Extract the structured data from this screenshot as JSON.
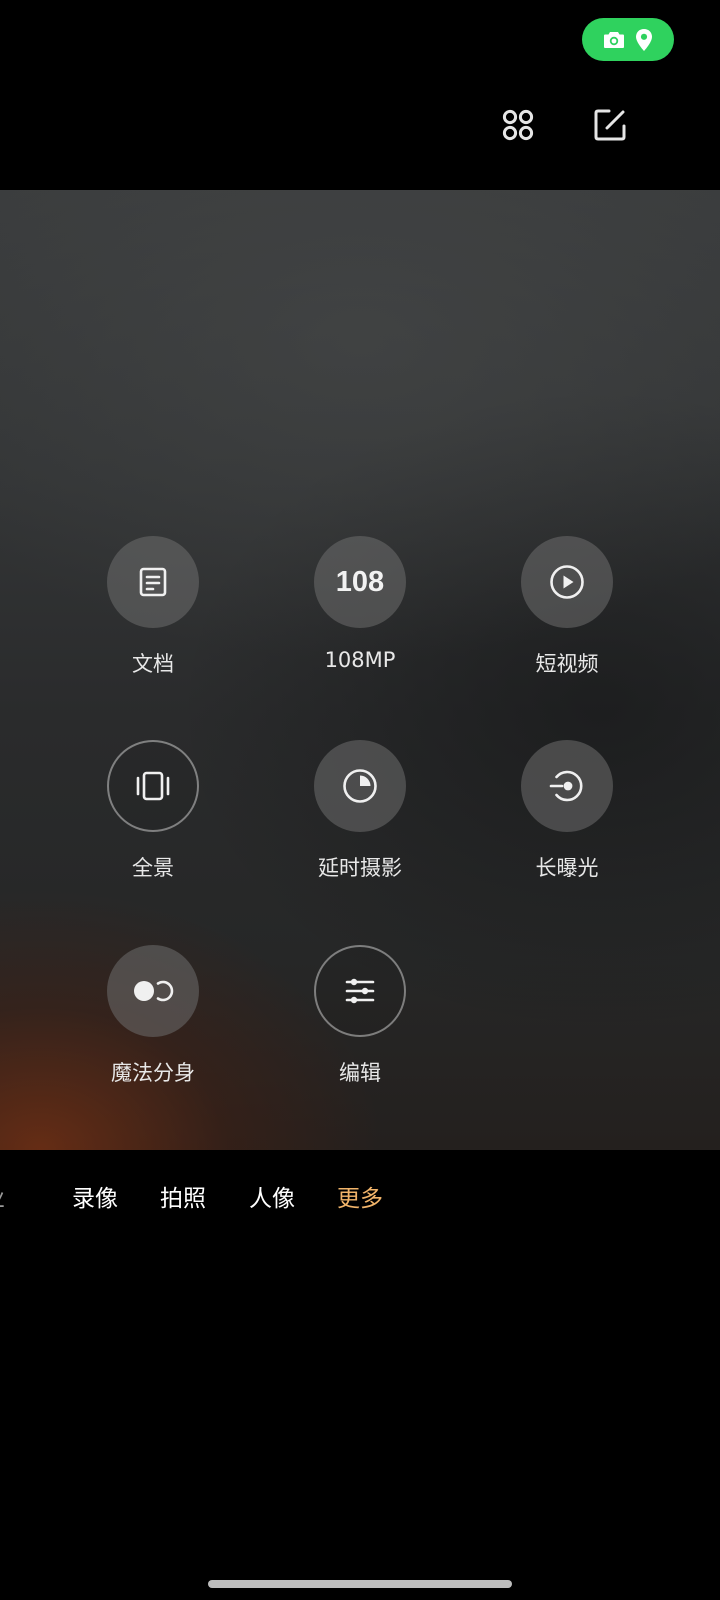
{
  "colors": {
    "status_pill": "#2fd25e",
    "accent_selected_tab": "#f1b46a",
    "background": "#000000"
  },
  "status_pill": {
    "icons": [
      "camera-icon",
      "location-pin-icon"
    ]
  },
  "toolbar": {
    "icons": [
      "more-apps-icon",
      "edit-icon"
    ]
  },
  "modes": {
    "document": {
      "label": "文档",
      "icon": "document-icon"
    },
    "mp108": {
      "label": "108MP",
      "badge": "108"
    },
    "short_video": {
      "label": "短视频",
      "icon": "play-icon"
    },
    "panorama": {
      "label": "全景",
      "icon": "panorama-icon"
    },
    "timelapse": {
      "label": "延时摄影",
      "icon": "timelapse-icon"
    },
    "long_exposure": {
      "label": "长曝光",
      "icon": "long-exposure-icon"
    },
    "clone": {
      "label": "魔法分身",
      "icon": "clone-icon"
    },
    "edit": {
      "label": "编辑",
      "icon": "sliders-icon"
    }
  },
  "mode_tabs": {
    "pro_partial": "业",
    "video": "录像",
    "photo": "拍照",
    "portrait": "人像",
    "more": "更多",
    "selected": "更多"
  }
}
